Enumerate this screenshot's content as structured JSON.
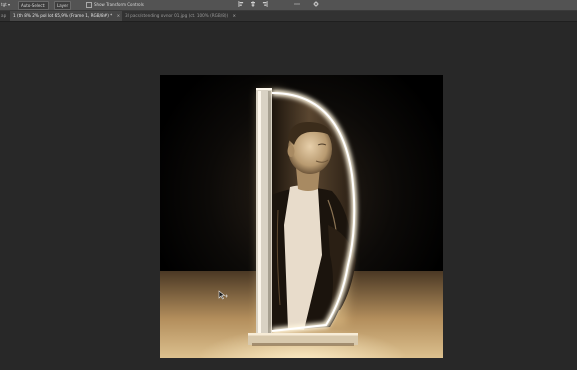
{
  "options_bar": {
    "left_partial": "tgt ▾",
    "field_1": "Auto-Select:",
    "field_2": "Layer",
    "show_transform_label": "Show Transform Controls"
  },
  "tabs": [
    {
      "label": "ap",
      "state": "partial"
    },
    {
      "label": "1 (th 8% 2% pol lot 65,9% (Frame 1, RGB/8#) *",
      "state": "active",
      "close": "×"
    },
    {
      "label": "3l pacs/stending ovnor 01.jpg (ct. 100% (RGB/8))",
      "state": "inactive",
      "close": "×"
    }
  ],
  "icons": {
    "align_left": "align-left-icon",
    "align_center": "align-center-icon",
    "align_right": "align-right-icon",
    "more": "ellipsis-icon",
    "settings": "gear-icon"
  },
  "colors": {
    "ui_background": "#282828",
    "options_bar": "#535353",
    "tab_active": "#474747",
    "glow": "#ffe7b8",
    "sepia": "#b89a70"
  }
}
